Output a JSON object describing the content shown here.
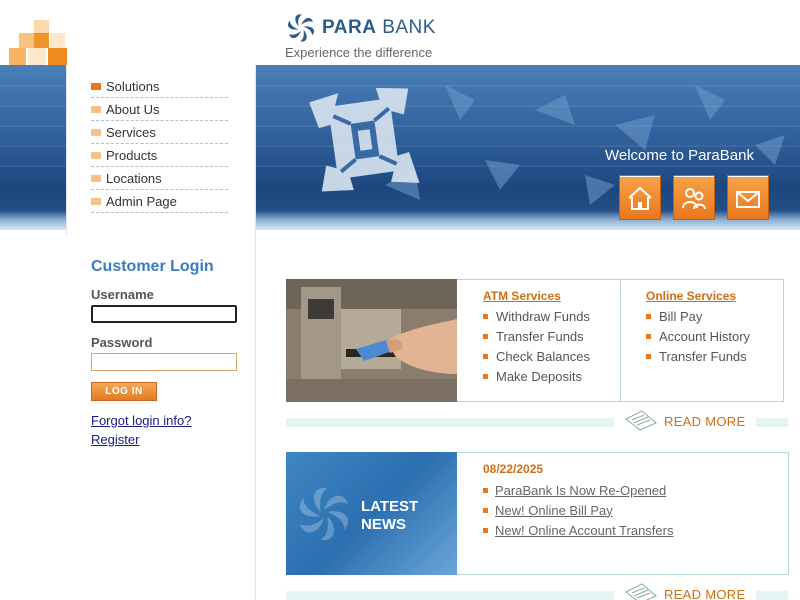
{
  "brand": {
    "name_bold": "PARA",
    "name_light": " BANK",
    "tagline": "Experience the difference",
    "colors": {
      "blue": "#2b5c8a",
      "orange": "#e8781e"
    }
  },
  "header": {
    "welcome": "Welcome to ParaBank",
    "buttons": [
      {
        "icon": "home-icon"
      },
      {
        "icon": "about-icon"
      },
      {
        "icon": "contact-icon"
      }
    ]
  },
  "menu": {
    "items": [
      {
        "label": "Solutions"
      },
      {
        "label": "About Us"
      },
      {
        "label": "Services"
      },
      {
        "label": "Products"
      },
      {
        "label": "Locations"
      },
      {
        "label": "Admin Page"
      }
    ]
  },
  "login": {
    "title": "Customer Login",
    "username_label": "Username",
    "username_value": "",
    "password_label": "Password",
    "password_value": "",
    "submit_label": "LOG IN",
    "forgot_label": "Forgot login info?",
    "register_label": "Register"
  },
  "services": {
    "atm": {
      "heading": "ATM Services",
      "items": [
        "Withdraw Funds",
        "Transfer Funds",
        "Check Balances",
        "Make Deposits"
      ]
    },
    "online": {
      "heading": "Online Services",
      "items": [
        "Bill Pay",
        "Account History",
        "Transfer Funds"
      ]
    },
    "read_more": "READ MORE"
  },
  "news": {
    "image_text_line1": "LATEST",
    "image_text_line2": "NEWS",
    "date": "08/22/2025",
    "items": [
      "ParaBank Is Now Re-Opened",
      "New! Online Bill Pay",
      "New! Online Account Transfers"
    ],
    "read_more": "READ MORE"
  }
}
